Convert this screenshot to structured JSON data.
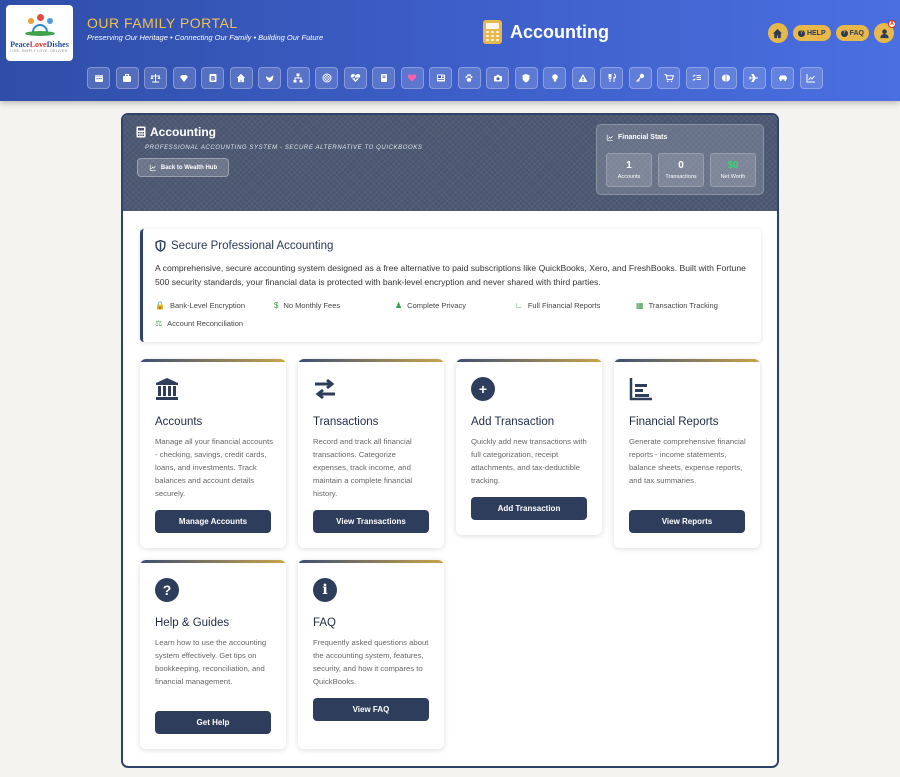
{
  "header": {
    "logo": {
      "brand_a": "Peace",
      "brand_b": "Love",
      "brand_c": "Dishes",
      "tagline": "LIVE. SIMPLY LOVE. DELIVER."
    },
    "portal_title": "OUR FAMILY PORTAL",
    "portal_subtitle": "Preserving Our Heritage • Connecting Our Family • Building Our Future",
    "page_title": "Accounting",
    "help_label": "HELP",
    "faq_label": "FAQ",
    "notification_badge": "A",
    "colors": {
      "accent": "#e8b94a",
      "bar": "#3d5ec8"
    }
  },
  "nav_icons": [
    "calendar-icon",
    "briefcase-icon",
    "scale-icon",
    "diamond-icon",
    "book-b-icon",
    "home-icon",
    "bird-icon",
    "org-chart-icon",
    "target-icon",
    "heart-pulse-icon",
    "book-icon",
    "heart-icon",
    "news-icon",
    "paw-icon",
    "camera-icon",
    "shield-icon",
    "lightbulb-icon",
    "warning-icon",
    "utensils-icon",
    "key-icon",
    "cart-icon",
    "checklist-icon",
    "brain-icon",
    "plane-icon",
    "car-icon",
    "chart-line-icon"
  ],
  "panel": {
    "title": "Accounting",
    "subtitle": "Professional Accounting System - Secure Alternative to QuickBooks",
    "back_label": "Back to Wealth Hub",
    "stats": {
      "title": "Financial Stats",
      "items": [
        {
          "value": "1",
          "label": "Accounts"
        },
        {
          "value": "0",
          "label": "Transactions"
        },
        {
          "value": "$0",
          "label": "Net Worth"
        }
      ]
    }
  },
  "intro": {
    "title": "Secure Professional Accounting",
    "text": "A comprehensive, secure accounting system designed as a free alternative to paid subscriptions like QuickBooks, Xero, and FreshBooks. Built with Fortune 500 security standards, your financial data is protected with bank-level encryption and never shared with third parties.",
    "features": [
      "Bank-Level Encryption",
      "No Monthly Fees",
      "Complete Privacy",
      "Full Financial Reports",
      "Transaction Tracking",
      "Account Reconciliation"
    ]
  },
  "cards": [
    {
      "title": "Accounts",
      "text": "Manage all your financial accounts - checking, savings, credit cards, loans, and investments. Track balances and account details securely.",
      "button": "Manage Accounts"
    },
    {
      "title": "Transactions",
      "text": "Record and track all financial transactions. Categorize expenses, track income, and maintain a complete financial history.",
      "button": "View Transactions"
    },
    {
      "title": "Add Transaction",
      "text": "Quickly add new transactions with full categorization, receipt attachments, and tax-deductible tracking.",
      "button": "Add Transaction"
    },
    {
      "title": "Financial Reports",
      "text": "Generate comprehensive financial reports - income statements, balance sheets, expense reports, and tax summaries.",
      "button": "View Reports"
    },
    {
      "title": "Help & Guides",
      "text": "Learn how to use the accounting system effectively. Get tips on bookkeeping, reconciliation, and financial management.",
      "button": "Get Help"
    },
    {
      "title": "FAQ",
      "text": "Frequently asked questions about the accounting system, features, security, and how it compares to QuickBooks.",
      "button": "View FAQ"
    }
  ]
}
